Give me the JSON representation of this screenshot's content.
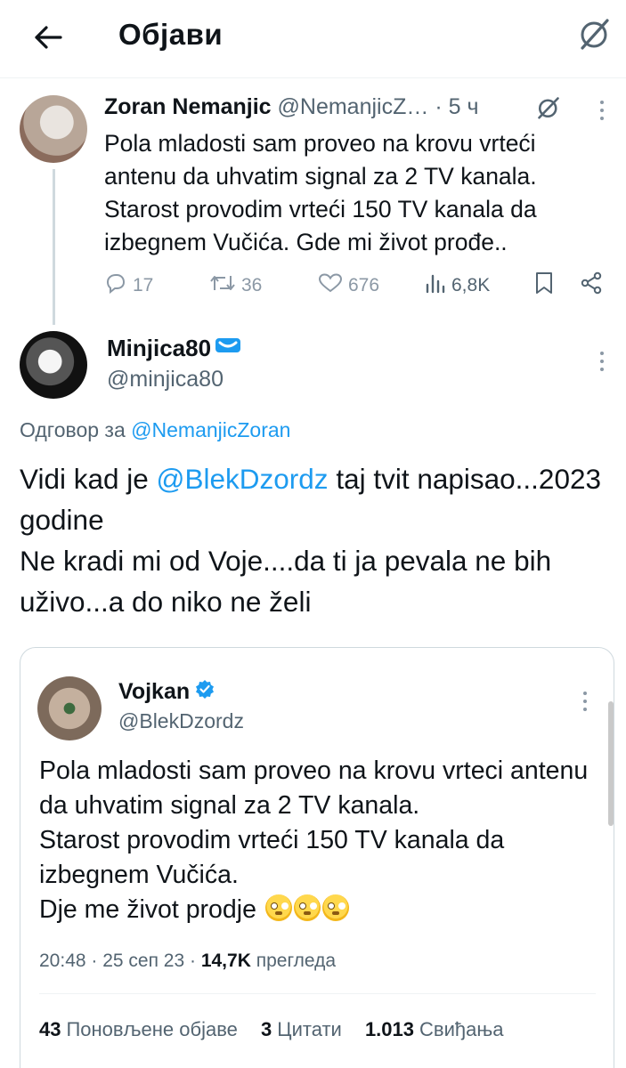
{
  "header": {
    "title": "Објави"
  },
  "original_tweet": {
    "name": "Zoran Nemanjic",
    "handle": "@NemanjicZ…",
    "dot": "·",
    "time": "5 ч",
    "text": "Pola mladosti sam proveo na krovu vrteći antenu da uhvatim signal za 2 TV kanala. Starost provodim vrteći 150 TV kanala da izbegnem Vučića. Gde mi život prođe..",
    "replies": "17",
    "retweets": "36",
    "likes": "676",
    "views": "6,8K"
  },
  "reply": {
    "name": "Minjica80",
    "handle": "@minjica80",
    "reply_to_label": "Одговор за",
    "reply_to_handle": "@NemanjicZoran",
    "text_part1": "Vidi kad je ",
    "mention": "@BlekDzordz",
    "text_part2": " taj tvit napisao...2023 godine",
    "text_line2": "Ne kradi mi od Voje....da ti ja pevala ne bih uživo...a do niko ne želi"
  },
  "quoted_tweet": {
    "name": "Vojkan",
    "handle": "@BlekDzordz",
    "text_line1": "Pola mladosti sam proveo na krovu vrteci antenu da uhvatim signal za 2 TV kanala.",
    "text_line2": "Starost provodim vrteći 150 TV kanala da izbegnem Vučića.",
    "text_line3": "Dje me život prodje",
    "time": "20:48 · 25 сеп 23 ·",
    "views_count": "14,7K",
    "views_label": "прегледа",
    "reposts_count": "43",
    "reposts_label": "Поновљене објаве",
    "quotes_count": "3",
    "quotes_label": "Цитати",
    "likes_count": "1.013",
    "likes_label": "Свиђања"
  },
  "colors": {
    "link": "#1d9bf0",
    "secondary_text": "#536471",
    "verified_blue": "#1d9bf0",
    "border": "#cfd9de"
  }
}
